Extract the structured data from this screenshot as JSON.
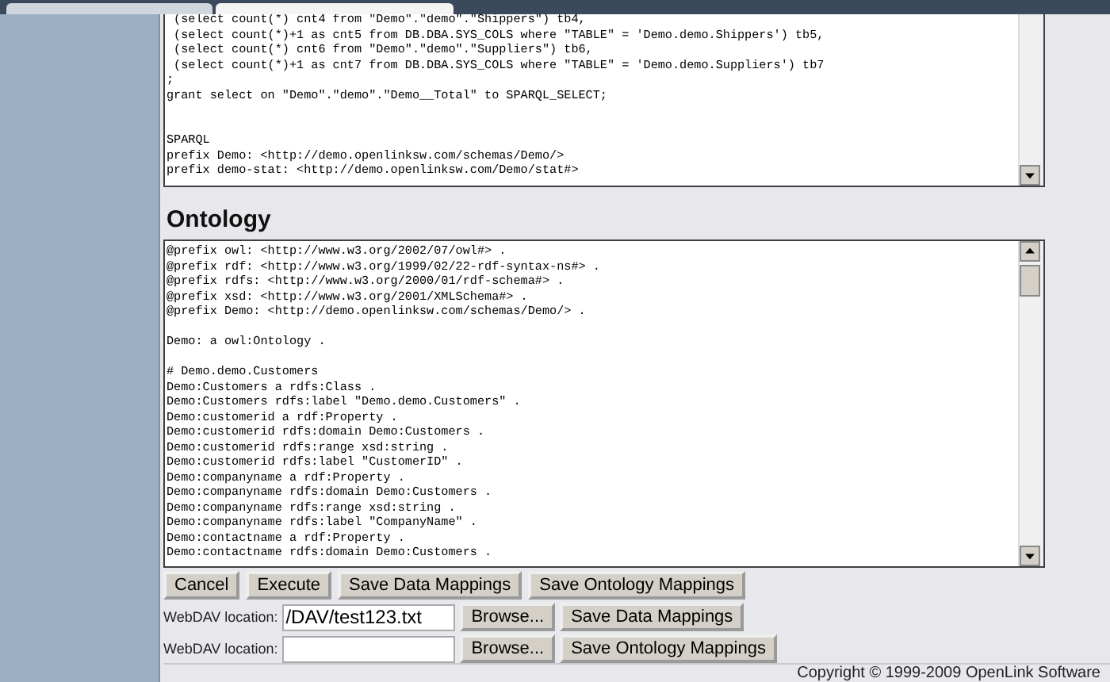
{
  "browser_tabs": [
    {
      "selected": false
    },
    {
      "selected": true
    }
  ],
  "sql_editor": {
    "lines": [
      {
        "kind": "code",
        "text": " (select count(*) cnt4 from \"Demo\".\"demo\".\"Shippers\") tb4,"
      },
      {
        "kind": "code",
        "text": " (select count(*)+1 as cnt5 from DB.DBA.SYS_COLS where \"TABLE\" = 'Demo.demo.Shippers') tb5,"
      },
      {
        "kind": "code",
        "text": " (select count(*) cnt6 from \"Demo\".\"demo\".\"Suppliers\") tb6,"
      },
      {
        "kind": "code",
        "text": " (select count(*)+1 as cnt7 from DB.DBA.SYS_COLS where \"TABLE\" = 'Demo.demo.Suppliers') tb7"
      },
      {
        "kind": "code",
        "text": ";"
      },
      {
        "kind": "code",
        "text": "grant select on \"Demo\".\"demo\".\"Demo__Total\" to SPARQL_SELECT;"
      },
      {
        "kind": "blank"
      },
      {
        "kind": "blank"
      },
      {
        "kind": "code",
        "text": "SPARQL"
      },
      {
        "kind": "code",
        "text": "prefix Demo: <http://demo.openlinksw.com/schemas/Demo/>"
      },
      {
        "kind": "code",
        "text": "prefix demo-stat: <http://demo.openlinksw.com/Demo/stat#>"
      }
    ]
  },
  "ontology": {
    "heading": "Ontology",
    "lines": [
      {
        "kind": "code",
        "text": "@prefix owl: <http://www.w3.org/2002/07/owl#> ."
      },
      {
        "kind": "code",
        "text": "@prefix rdf: <http://www.w3.org/1999/02/22-rdf-syntax-ns#> ."
      },
      {
        "kind": "code",
        "text": "@prefix rdfs: <http://www.w3.org/2000/01/rdf-schema#> ."
      },
      {
        "kind": "code",
        "text": "@prefix xsd: <http://www.w3.org/2001/XMLSchema#> ."
      },
      {
        "kind": "code",
        "text": "@prefix Demo: <http://demo.openlinksw.com/schemas/Demo/> ."
      },
      {
        "kind": "blank"
      },
      {
        "kind": "code",
        "text": "Demo: a owl:Ontology ."
      },
      {
        "kind": "blank"
      },
      {
        "kind": "code",
        "text": "# Demo.demo.Customers"
      },
      {
        "kind": "code",
        "text": "Demo:Customers a rdfs:Class ."
      },
      {
        "kind": "code",
        "text": "Demo:Customers rdfs:label \"Demo.demo.Customers\" ."
      },
      {
        "kind": "code",
        "text": "Demo:customerid a rdf:Property ."
      },
      {
        "kind": "code",
        "text": "Demo:customerid rdfs:domain Demo:Customers ."
      },
      {
        "kind": "code",
        "text": "Demo:customerid rdfs:range xsd:string ."
      },
      {
        "kind": "code",
        "text": "Demo:customerid rdfs:label \"CustomerID\" ."
      },
      {
        "kind": "code",
        "text": "Demo:companyname a rdf:Property ."
      },
      {
        "kind": "code",
        "text": "Demo:companyname rdfs:domain Demo:Customers ."
      },
      {
        "kind": "code",
        "text": "Demo:companyname rdfs:range xsd:string ."
      },
      {
        "kind": "code",
        "text": "Demo:companyname rdfs:label \"CompanyName\" ."
      },
      {
        "kind": "code",
        "text": "Demo:contactname a rdf:Property ."
      },
      {
        "kind": "code",
        "text": "Demo:contactname rdfs:domain Demo:Customers ."
      }
    ]
  },
  "actions": [
    "Cancel",
    "Execute",
    "Save Data Mappings",
    "Save Ontology Mappings"
  ],
  "webdav_rows": [
    {
      "label": "WebDAV location:",
      "value": "/DAV/test123.txt",
      "browse": "Browse...",
      "save": "Save Data Mappings"
    },
    {
      "label": "WebDAV location:",
      "value": "",
      "browse": "Browse...",
      "save": "Save Ontology Mappings"
    }
  ],
  "footer": "Copyright © 1999-2009 OpenLink Software"
}
